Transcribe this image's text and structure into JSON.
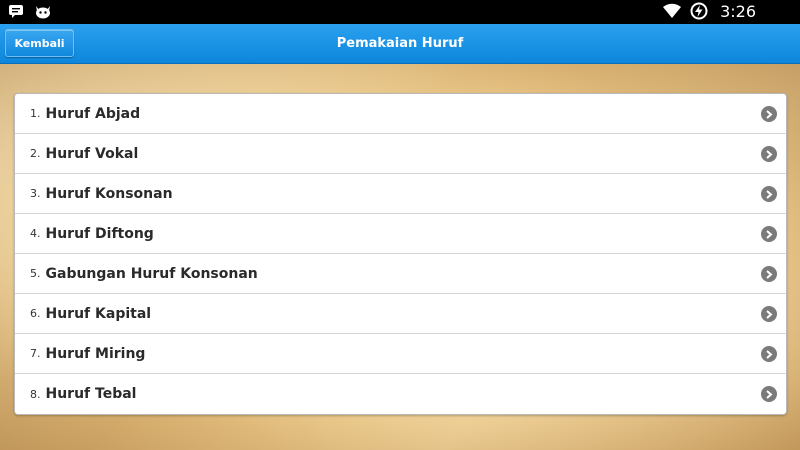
{
  "status_bar": {
    "time": "3:26",
    "left_icons": [
      "chat-notification-icon",
      "android-cat-icon"
    ],
    "right_icons": [
      "wifi-icon",
      "battery-charging-icon"
    ]
  },
  "action_bar": {
    "back_label": "Kembali",
    "title": "Pemakaian Huruf",
    "color": "#0c86dc"
  },
  "menu": {
    "items": [
      {
        "number": "1.",
        "label": "Huruf Abjad"
      },
      {
        "number": "2.",
        "label": "Huruf Vokal"
      },
      {
        "number": "3.",
        "label": "Huruf Konsonan"
      },
      {
        "number": "4.",
        "label": "Huruf Diftong"
      },
      {
        "number": "5.",
        "label": "Gabungan Huruf Konsonan"
      },
      {
        "number": "6.",
        "label": "Huruf Kapital"
      },
      {
        "number": "7.",
        "label": "Huruf Miring"
      },
      {
        "number": "8.",
        "label": "Huruf Tebal"
      }
    ],
    "chevron_icon": "chevron-right-circle-icon"
  }
}
